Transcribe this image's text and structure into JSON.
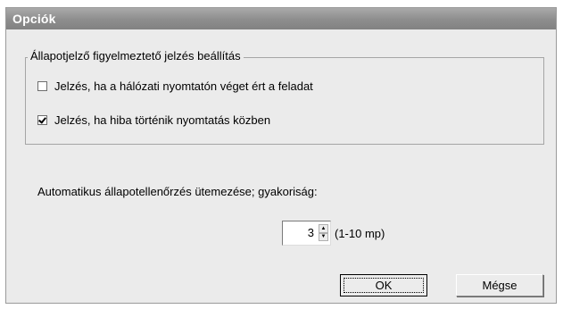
{
  "window": {
    "title": "Opciók"
  },
  "status_group": {
    "legend": "Állapotjelző figyelmeztető jelzés beállítás",
    "options": [
      {
        "label": "Jelzés, ha a hálózati nyomtatón véget ért a feladat",
        "checked": false
      },
      {
        "label": "Jelzés, ha hiba történik nyomtatás közben",
        "checked": true
      }
    ]
  },
  "frequency": {
    "label": "Automatikus állapotellenőrzés ütemezése; gyakoriság:",
    "value": "3",
    "range": "(1-10 mp)"
  },
  "buttons": {
    "ok": "OK",
    "cancel": "Mégse"
  }
}
